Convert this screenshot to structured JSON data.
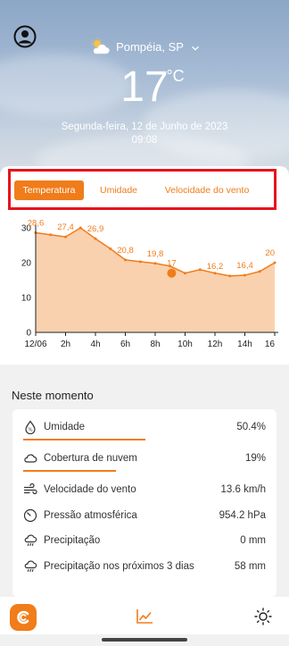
{
  "header": {
    "location": "Pompéia, SP",
    "temperature": "17",
    "degree_symbol": "°C",
    "date": "Segunda-feira, 12 de Junho de 2023",
    "time": "09:08",
    "weather_icon": "partly-cloudy-icon",
    "profile_icon": "account-circle-icon"
  },
  "tabs": [
    {
      "label": "Temperatura",
      "active": true
    },
    {
      "label": "Umidade",
      "active": false
    },
    {
      "label": "Velocidade do vento",
      "active": false
    }
  ],
  "chart_data": {
    "type": "area",
    "x_ticks": [
      "12/06",
      "2h",
      "4h",
      "6h",
      "8h",
      "10h",
      "12h",
      "14h",
      "16"
    ],
    "y_ticks": [
      "0",
      "10",
      "20",
      "30"
    ],
    "ylim": [
      0,
      30
    ],
    "xlim": [
      0,
      16
    ],
    "series": [
      {
        "x": [
          0,
          1,
          2,
          3,
          4,
          5,
          6,
          7,
          8,
          9,
          10,
          11,
          12,
          13,
          14,
          15,
          16
        ],
        "values": [
          28.6,
          28,
          27.4,
          30,
          26.9,
          24,
          20.8,
          20.3,
          19.8,
          19,
          17,
          18,
          17,
          16.2,
          16.4,
          17.5,
          20
        ]
      }
    ],
    "data_labels": [
      {
        "x": 0,
        "y": 28.6,
        "text": "28,6"
      },
      {
        "x": 2,
        "y": 27.4,
        "text": "27,4"
      },
      {
        "x": 4,
        "y": 26.9,
        "text": "26,9"
      },
      {
        "x": 6,
        "y": 20.8,
        "text": "20,8"
      },
      {
        "x": 8,
        "y": 19.8,
        "text": "19,8"
      },
      {
        "x": 9.1,
        "y": 17,
        "text": "17"
      },
      {
        "x": 12,
        "y": 16.2,
        "text": "16,2"
      },
      {
        "x": 14,
        "y": 16.4,
        "text": "16,4"
      },
      {
        "x": 16,
        "y": 20,
        "text": "20"
      }
    ],
    "current_point": {
      "x": 9.1,
      "y": 17
    },
    "line_color": "#f07c1a",
    "fill_color": "#f8c9a0"
  },
  "now": {
    "title": "Neste momento",
    "items": [
      {
        "label": "Umidade",
        "value": "50.4%",
        "icon": "humidity-icon"
      },
      {
        "label": "Cobertura de nuvem",
        "value": "19%",
        "icon": "cloud-icon"
      },
      {
        "label": "Velocidade do vento",
        "value": "13.6 km/h",
        "icon": "wind-icon"
      },
      {
        "label": "Pressão atmosférica",
        "value": "954.2 hPa",
        "icon": "gauge-icon"
      },
      {
        "label": "Precipitação",
        "value": "0 mm",
        "icon": "rain-icon"
      },
      {
        "label": "Precipitação nos próximos 3 dias",
        "value": "58 mm",
        "icon": "rain-icon"
      }
    ]
  },
  "nav": {
    "items": [
      {
        "icon": "app-logo-icon"
      },
      {
        "icon": "chart-icon"
      },
      {
        "icon": "sun-icon"
      }
    ]
  },
  "colors": {
    "accent": "#f07c1a",
    "highlight": "#e8131d"
  }
}
